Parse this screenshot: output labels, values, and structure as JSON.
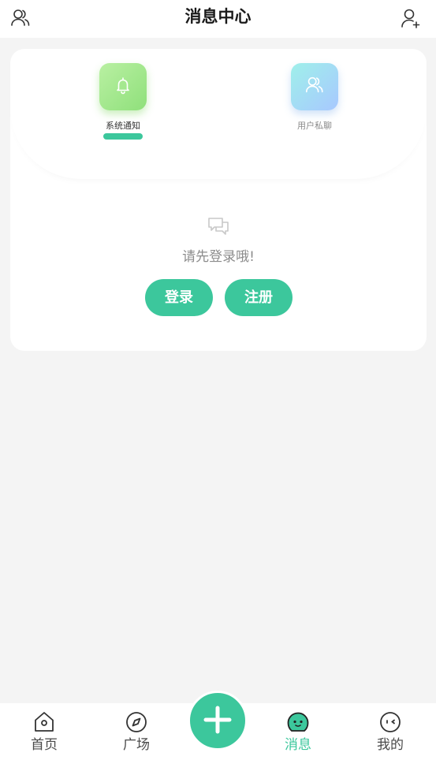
{
  "header": {
    "title": "消息中心",
    "left_icon": "users-icon",
    "right_icon": "add-user-icon"
  },
  "tabs": [
    {
      "label": "系统通知",
      "icon": "bell-icon",
      "active": true
    },
    {
      "label": "用户私聊",
      "icon": "users-icon",
      "active": false
    }
  ],
  "empty_state": {
    "icon": "chat-bubbles-icon",
    "message": "请先登录哦!",
    "login_label": "登录",
    "register_label": "注册"
  },
  "bottom_nav": {
    "items": [
      {
        "label": "首页",
        "icon": "home-icon",
        "active": false
      },
      {
        "label": "广场",
        "icon": "compass-icon",
        "active": false
      },
      {
        "label": "消息",
        "icon": "message-icon",
        "active": true
      },
      {
        "label": "我的",
        "icon": "profile-face-icon",
        "active": false
      }
    ],
    "center_icon": "plus-icon"
  },
  "colors": {
    "accent": "#3cc79c",
    "background": "#f4f4f4",
    "card": "#ffffff",
    "text_dark": "#1a1a1a",
    "text_muted": "#8c8c8c"
  }
}
